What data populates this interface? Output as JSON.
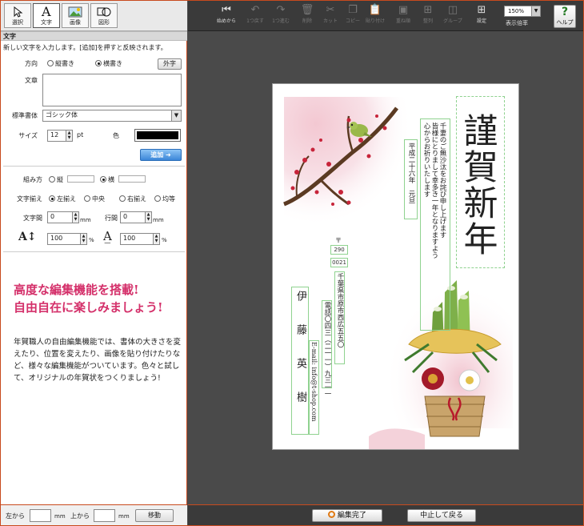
{
  "tools": [
    {
      "label": "選択",
      "icon": "cursor-icon"
    },
    {
      "label": "文字",
      "icon": "text-a-icon"
    },
    {
      "label": "画像",
      "icon": "image-icon"
    },
    {
      "label": "図形",
      "icon": "shape-icon"
    }
  ],
  "text_panel": {
    "header": "文字",
    "instruction": "新しい文字を入力します。[追加]を押すと反映されます。",
    "direction_label": "方向",
    "direction_vertical": "縦書き",
    "direction_horizontal": "横書き",
    "direction_selected": "横書き",
    "gaiji_button": "外字",
    "text_label": "文章",
    "text_value": "",
    "font_label": "標準書体",
    "font_value": "ゴシック体",
    "size_label": "サイズ",
    "size_value": "12",
    "size_unit": "pt",
    "color_label": "色",
    "color_value": "#000000",
    "add_button": "追加"
  },
  "layout_panel": {
    "kumi_label": "組み方",
    "kumi_vertical": "縦",
    "kumi_horizontal": "横",
    "kumi_selected": "横",
    "align_label": "文字揃え",
    "align_left": "左揃え",
    "align_center": "中央",
    "align_right": "右揃え",
    "align_justify": "均等",
    "align_selected": "左揃え",
    "char_spacing_label": "文字間",
    "char_spacing_value": "0",
    "line_spacing_label": "行間",
    "line_spacing_value": "0",
    "unit_mm": "mm",
    "width_pct_value": "100",
    "height_pct_value": "100",
    "unit_pct": "%"
  },
  "promo": {
    "line1": "高度な編集機能を搭載!",
    "line2": "自由自在に楽しみましょう!",
    "description": "年賀職人の自由編集機能では、書体の大きさを変えたり、位置を変えたり、画像を貼り付けたりなど、様々な編集機能がついています。色々と試して、オリジナルの年賀状をつくりましょう!"
  },
  "position_bar": {
    "from_left_label": "左から",
    "from_left_value": "",
    "from_top_label": "上から",
    "from_top_value": "",
    "unit": "mm",
    "move_button": "移動"
  },
  "toolbar": {
    "items": [
      {
        "label": "始めから",
        "icon": "rewind-icon",
        "enabled": true
      },
      {
        "label": "1つ戻す",
        "icon": "undo-icon",
        "enabled": false
      },
      {
        "label": "1つ進む",
        "icon": "redo-icon",
        "enabled": false
      },
      {
        "label": "削除",
        "icon": "trash-icon",
        "enabled": false
      },
      {
        "label": "カット",
        "icon": "scissors-icon",
        "enabled": false
      },
      {
        "label": "コピー",
        "icon": "copy-icon",
        "enabled": false
      },
      {
        "label": "貼り付け",
        "icon": "paste-icon",
        "enabled": false
      },
      {
        "label": "重ね順",
        "icon": "layer-order-icon",
        "enabled": false
      },
      {
        "label": "整列",
        "icon": "align-icon",
        "enabled": false
      },
      {
        "label": "グループ",
        "icon": "group-icon",
        "enabled": false
      },
      {
        "label": "設定",
        "icon": "grid-icon",
        "enabled": true
      }
    ],
    "zoom_value": "150%",
    "zoom_label": "表示倍率",
    "help_label": "ヘルプ"
  },
  "bottom_bar": {
    "finish_button": "編集完了",
    "cancel_button": "中止して戻る"
  },
  "card": {
    "title": "謹賀新年",
    "message_col1": "千妻のご無沙汰をお詫び申し上げます",
    "message_col2": "皆様にとりまして幸多き一年となりますよう",
    "message_col3": "心からお祈りいたします",
    "date_line": "平成二十六年　元旦",
    "postal_mark": "〒",
    "postal_code1": "290",
    "postal_code2": "0021",
    "address": "千葉県市原市西広五五〇",
    "phone": "電話〇四三（二一一）九三一一",
    "email": "E-mail: info@t-shop.com",
    "name": "伊藤英樹",
    "accent_pink": "#e8aab8",
    "accent_green": "#8fd28f"
  }
}
